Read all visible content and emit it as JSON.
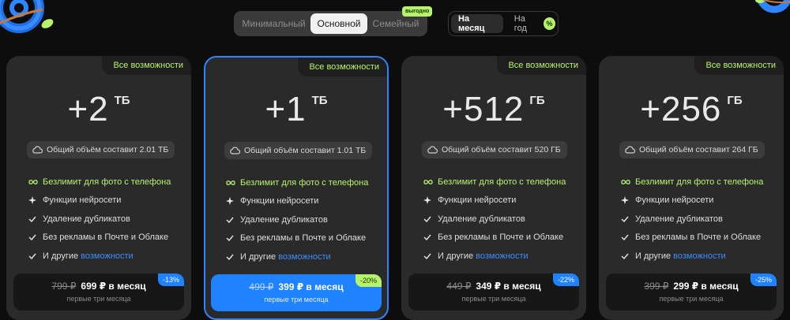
{
  "plan_tabs": [
    {
      "label": "Минимальный"
    },
    {
      "label": "Основной"
    },
    {
      "label": "Семейный"
    }
  ],
  "badge_label": "выгодно",
  "period_tabs": [
    {
      "label": "На месяц"
    },
    {
      "label": "На год"
    }
  ],
  "period_badge": "%",
  "cards": [
    {
      "tag": "Все возможности",
      "amount": "+2",
      "unit": "ТБ",
      "total": "Общий объём составит 2.01 ТБ",
      "features": [
        "Безлимит для фото с телефона",
        "Функции нейросети",
        "Удаление дубликатов",
        "Без рекламы в Почте и Облаке",
        "И другие"
      ],
      "features_link": "возможности",
      "old_price": "799 ₽",
      "new_price": "699 ₽ в месяц",
      "price_note": "первые три месяца",
      "discount": "-13%"
    },
    {
      "tag": "Все возможности",
      "amount": "+1",
      "unit": "ТБ",
      "total": "Общий объём составит 1.01 ТБ",
      "features": [
        "Безлимит для фото с телефона",
        "Функции нейросети",
        "Удаление дубликатов",
        "Без рекламы в Почте и Облаке",
        "И другие"
      ],
      "features_link": "возможности",
      "old_price": "499 ₽",
      "new_price": "399 ₽ в месяц",
      "price_note": "первые три месяца",
      "discount": "-20%"
    },
    {
      "tag": "Все возможности",
      "amount": "+512",
      "unit": "ГБ",
      "total": "Общий объём составит 520 ГБ",
      "features": [
        "Безлимит для фото с телефона",
        "Функции нейросети",
        "Удаление дубликатов",
        "Без рекламы в Почте и Облаке",
        "И другие"
      ],
      "features_link": "возможности",
      "old_price": "449 ₽",
      "new_price": "349 ₽ в месяц",
      "price_note": "первые три месяца",
      "discount": "-22%"
    },
    {
      "tag": "Все возможности",
      "amount": "+256",
      "unit": "ГБ",
      "total": "Общий объём составит 264 ГБ",
      "features": [
        "Безлимит для фото с телефона",
        "Функции нейросети",
        "Удаление дубликатов",
        "Без рекламы в Почте и Облаке",
        "И другие"
      ],
      "features_link": "возможности",
      "old_price": "399 ₽",
      "new_price": "299 ₽ в месяц",
      "price_note": "первые три месяца",
      "discount": "-25%"
    }
  ],
  "colors": {
    "accent_blue": "#1f82ff",
    "accent_lime": "#b6f36b",
    "card_bg": "#2a2a2a",
    "page_bg": "#0d0d0d"
  },
  "icons": [
    "cloud-icon",
    "infinity-icon",
    "sparkle-icon",
    "check-icon",
    "at-sign-decoration"
  ]
}
